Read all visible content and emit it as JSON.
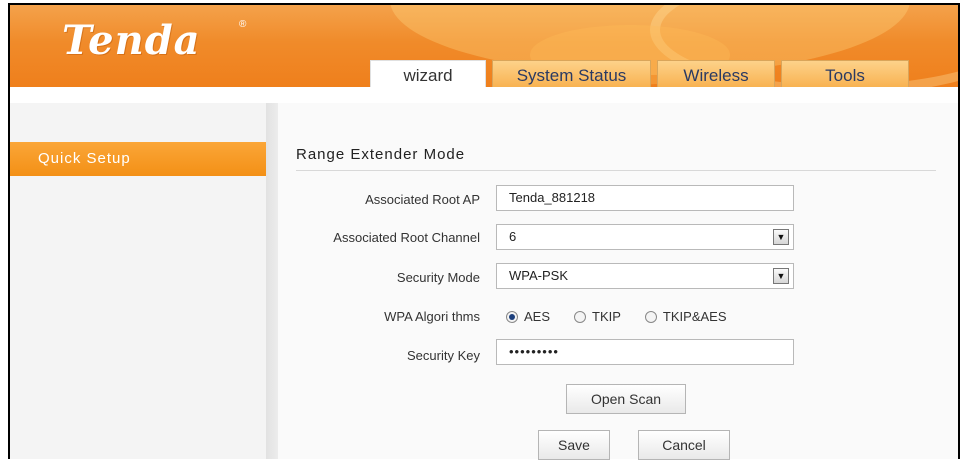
{
  "brand": {
    "logo_text": "Tenda",
    "registered_mark": "®"
  },
  "tabs": [
    {
      "label": "wizard",
      "active": true
    },
    {
      "label": "System Status",
      "active": false
    },
    {
      "label": "Wireless",
      "active": false
    },
    {
      "label": "Tools",
      "active": false
    }
  ],
  "sidebar": {
    "items": [
      {
        "label": "Quick Setup",
        "active": true
      }
    ]
  },
  "form": {
    "section_title": "Range  Extender Mode",
    "root_ap": {
      "label": "Associated Root AP",
      "value": "Tenda_881218"
    },
    "root_channel": {
      "label": "Associated Root Channel",
      "value": "6"
    },
    "security_mode": {
      "label": "Security Mode",
      "value": "WPA-PSK"
    },
    "algorithms": {
      "label": "WPA Algori thms",
      "options": [
        "AES",
        "TKIP",
        "TKIP&AES"
      ],
      "selected": "AES"
    },
    "security_key": {
      "label": "Security Key",
      "value": "•••••••••"
    }
  },
  "buttons": {
    "open_scan": "Open Scan",
    "save": "Save",
    "cancel": "Cancel"
  },
  "colors": {
    "header_orange": "#f08b2a",
    "sidebar_active": "#f39016",
    "tab_text": "#2a3a63"
  },
  "icons": {
    "dropdown": "chevron-down-icon",
    "radio": "radio-icon"
  }
}
